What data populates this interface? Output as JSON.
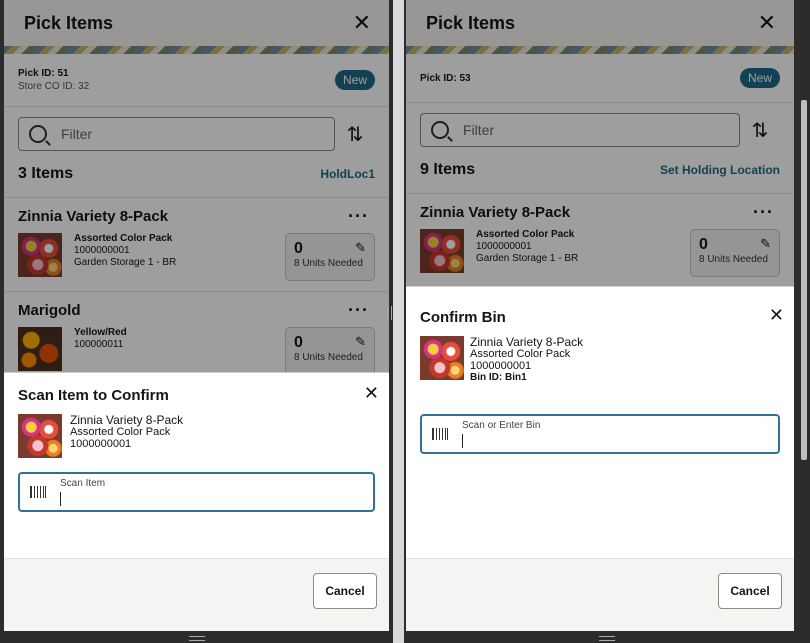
{
  "left": {
    "title": "Pick Items",
    "pick_id": "Pick ID: 51",
    "store_co": "Store CO ID: 32",
    "badge": "New",
    "filter_placeholder": "Filter",
    "count": "3 Items",
    "holding_link": "HoldLoc1",
    "items": [
      {
        "name": "Zinnia Variety 8-Pack",
        "sub": "Assorted Color Pack",
        "sku": "1000000001",
        "location": "Garden Storage 1 - BR",
        "qty": "0",
        "needed": "8 Units Needed"
      },
      {
        "name": "Marigold",
        "sub": "Yellow/Red",
        "sku": "100000011",
        "location": "",
        "qty": "0",
        "needed": "8 Units Needed"
      }
    ],
    "sheet": {
      "title": "Scan Item to Confirm",
      "item_name": "Zinnia Variety 8-Pack",
      "item_sub": "Assorted Color Pack",
      "item_sku": "1000000001",
      "scan_label": "Scan Item",
      "cancel": "Cancel"
    }
  },
  "right": {
    "title": "Pick Items",
    "pick_id": "Pick ID: 53",
    "badge": "New",
    "filter_placeholder": "Filter",
    "count": "9 Items",
    "holding_link": "Set Holding Location",
    "items": [
      {
        "name": "Zinnia Variety 8-Pack",
        "sub": "Assorted Color Pack",
        "sku": "1000000001",
        "location": "Garden Storage 1 - BR",
        "qty": "0",
        "needed": "8 Units Needed"
      }
    ],
    "sheet": {
      "title": "Confirm Bin",
      "item_name": "Zinnia Variety 8-Pack",
      "item_sub": "Assorted Color Pack",
      "item_sku": "1000000001",
      "bin": "Bin ID: Bin1",
      "scan_label": "Scan or Enter Bin",
      "cancel": "Cancel"
    }
  },
  "icons": {
    "close": "close-icon",
    "search": "search-icon",
    "sort": "sort-icon",
    "more": "more-icon",
    "edit": "pencil-icon",
    "barcode": "barcode-icon"
  },
  "colors": {
    "accent": "#1d6a88",
    "focus_border": "#2e7394"
  }
}
